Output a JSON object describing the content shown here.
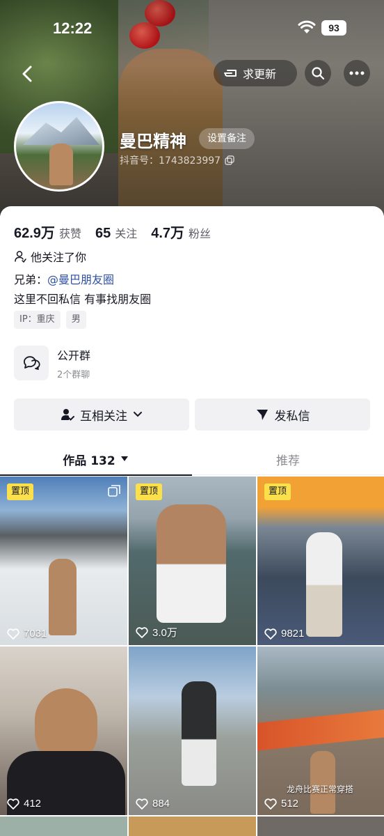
{
  "status_bar": {
    "time": "12:22",
    "battery": "93"
  },
  "nav": {
    "update_label": "求更新"
  },
  "profile": {
    "name": "曼巴精神",
    "remark_label": "设置备注",
    "douyin_id": "抖音号：1743823997"
  },
  "stats": [
    {
      "num": "62.9万",
      "label": "获赞"
    },
    {
      "num": "65",
      "label": "关注"
    },
    {
      "num": "4.7万",
      "label": "粉丝"
    }
  ],
  "bio": {
    "follows_you": "他关注了你",
    "line1_prefix": "兄弟：",
    "line1_mention": "@曼巴朋友圈",
    "line2": "这里不回私信 有事找朋友圈",
    "tags": [
      "IP：重庆",
      "男"
    ]
  },
  "group": {
    "title": "公开群",
    "subtitle": "2个群聊"
  },
  "actions": {
    "mutual_follow": "互相关注",
    "message": "发私信"
  },
  "tabs": {
    "works": "作品 132",
    "recommend": "推荐"
  },
  "videos": [
    {
      "pinned": "置顶",
      "likes": "7031",
      "multi": true,
      "caption": ""
    },
    {
      "pinned": "置顶",
      "likes": "3.0万",
      "multi": false,
      "caption": ""
    },
    {
      "pinned": "置顶",
      "likes": "9821",
      "multi": false,
      "caption": ""
    },
    {
      "pinned": "",
      "likes": "412",
      "multi": false,
      "caption": ""
    },
    {
      "pinned": "",
      "likes": "884",
      "multi": false,
      "caption": ""
    },
    {
      "pinned": "",
      "likes": "512",
      "multi": false,
      "caption": "龙舟比赛正常穿搭"
    }
  ],
  "colors": {
    "mention": "#2b4f9e",
    "pin_badge": "#fbe04b",
    "button_bg": "#f1f1f3"
  }
}
